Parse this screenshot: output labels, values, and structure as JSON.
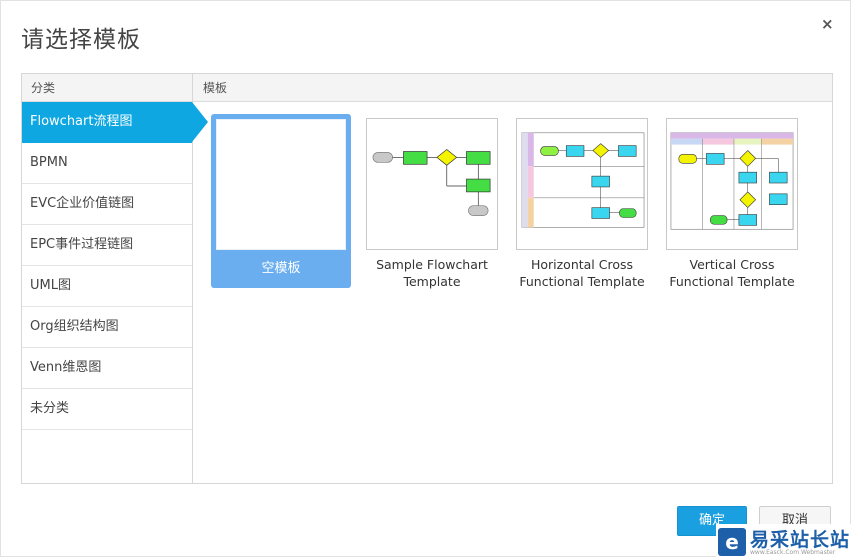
{
  "dialog": {
    "title": "请选择模板",
    "close_icon": "×"
  },
  "categories": {
    "header": "分类",
    "items": [
      {
        "label": "Flowchart流程图",
        "active": true
      },
      {
        "label": "BPMN"
      },
      {
        "label": "EVC企业价值链图"
      },
      {
        "label": "EPC事件过程链图"
      },
      {
        "label": "UML图"
      },
      {
        "label": "Org组织结构图"
      },
      {
        "label": "Venn维恩图"
      },
      {
        "label": "未分类"
      }
    ]
  },
  "templates": {
    "header": "模板",
    "items": [
      {
        "label": "空模板",
        "selected": true
      },
      {
        "label_line1": "Sample Flowchart",
        "label_line2": "Template"
      },
      {
        "label_line1": "Horizontal Cross",
        "label_line2": "Functional Template"
      },
      {
        "label_line1": "Vertical Cross",
        "label_line2": "Functional Template"
      }
    ]
  },
  "footer": {
    "ok_label": "确定",
    "cancel_label": "取消"
  },
  "watermark": {
    "logo_glyph": "e",
    "name": "易采站长站",
    "sub": "www.Easck.Com Webmaster"
  },
  "colors": {
    "accent": "#0ea7e2",
    "selected_template": "#6aaef0",
    "ok_button": "#1aa0e0"
  }
}
